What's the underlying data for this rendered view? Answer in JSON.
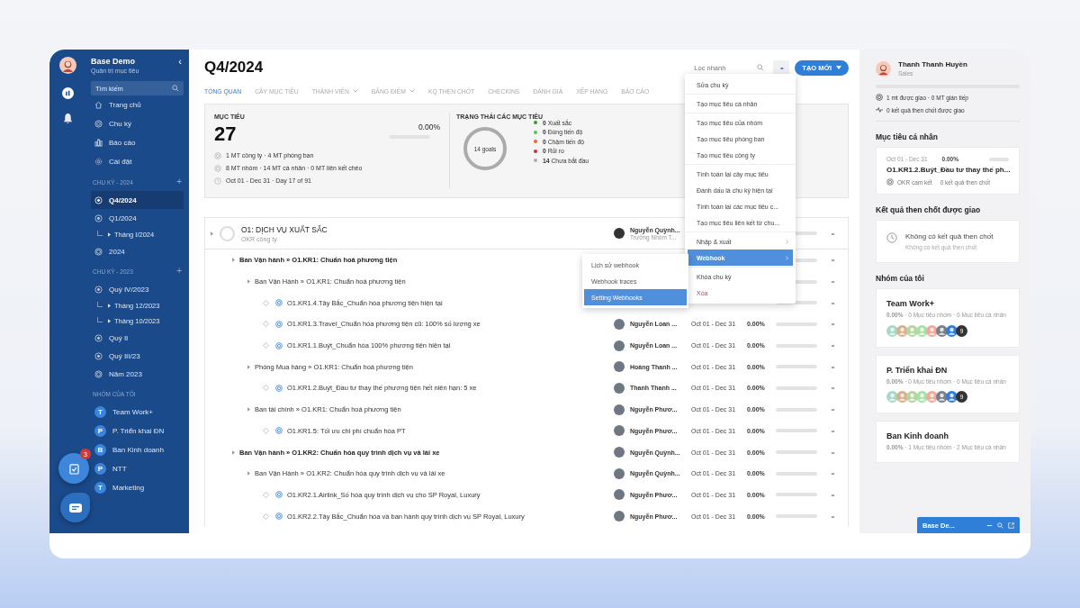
{
  "sidebar": {
    "brand": "Base Demo",
    "subtitle": "Quản trị mục tiêu",
    "collapse": "‹",
    "search": {
      "placeholder": "Tìm kiếm"
    },
    "nav": [
      {
        "label": "Trang chủ",
        "kind": "home"
      },
      {
        "label": "Chu kỳ",
        "kind": "target"
      },
      {
        "label": "Báo cáo",
        "kind": "chart"
      },
      {
        "label": "Cài đặt",
        "kind": "gear"
      }
    ],
    "sections": [
      {
        "title": "CHU KỲ - 2024",
        "add": "+",
        "items": [
          {
            "label": "Q4/2024",
            "kind": "quarter",
            "selected": true
          },
          {
            "label": "Q1/2024",
            "kind": "quarter",
            "selected": false,
            "children": [
              {
                "label": "Tháng I/2024",
                "selected": false
              }
            ]
          },
          {
            "label": "2024",
            "kind": "year",
            "selected": false
          }
        ]
      },
      {
        "title": "CHU KỲ - 2023",
        "add": "+",
        "items": [
          {
            "label": "Quý IV/2023",
            "kind": "quarter",
            "selected": false,
            "children": [
              {
                "label": "Tháng 12/2023",
                "selected": false
              },
              {
                "label": "Tháng 10/2023",
                "selected": false
              }
            ]
          },
          {
            "label": "Quý II",
            "kind": "quarter",
            "selected": false
          },
          {
            "label": "Quý III/23",
            "kind": "quarter",
            "selected": false
          },
          {
            "label": "Năm 2023",
            "kind": "year",
            "selected": false
          }
        ]
      }
    ],
    "groups_title": "NHÓM CỦA TÔI",
    "groups": [
      {
        "letter": "T",
        "label": "Team Work+"
      },
      {
        "letter": "P",
        "label": "P. Triển khai ĐN"
      },
      {
        "letter": "B",
        "label": "Ban Kinh doanh"
      },
      {
        "letter": "P",
        "label": "NTT"
      },
      {
        "letter": "T",
        "label": "Marketing"
      }
    ],
    "task_badge": "3"
  },
  "header": {
    "title": "Q4/2024",
    "filter": {
      "placeholder": "Lọc nhanh"
    },
    "more": "••",
    "create": "TẠO MỚI"
  },
  "tabs": [
    {
      "label": "TỔNG QUAN",
      "selected": true,
      "dropdown": false
    },
    {
      "label": "CÂY MỤC TIÊU",
      "selected": false,
      "dropdown": false
    },
    {
      "label": "THÀNH VIÊN",
      "selected": false,
      "dropdown": true
    },
    {
      "label": "BẢNG ĐIỂM",
      "selected": false,
      "dropdown": true
    },
    {
      "label": "KQ THEN CHỐT",
      "selected": false,
      "dropdown": false
    },
    {
      "label": "CHECKINS",
      "selected": false,
      "dropdown": false
    },
    {
      "label": "ĐÁNH GIÁ",
      "selected": false,
      "dropdown": false
    },
    {
      "label": "XẾP HẠNG",
      "selected": false,
      "dropdown": false
    },
    {
      "label": "BÁO CÁO",
      "selected": false,
      "dropdown": false
    }
  ],
  "summary": {
    "title": "MỤC TIÊU",
    "count": "27",
    "percent": "0.00%",
    "level": 0,
    "lines": [
      {
        "kind": "target",
        "text": "1 MT công ty · 4 MT phòng ban"
      },
      {
        "kind": "target",
        "text": "8 MT nhóm · 14 MT cá nhân · 0 MT liên kết chéo"
      },
      {
        "kind": "clock",
        "text": "Oct 01 - Dec 31 · Day 17 of 91"
      }
    ],
    "status_title": "TRẠNG THÁI CÁC MỤC TIÊU",
    "donut_label": "14 goals",
    "statuses": [
      {
        "count": "0",
        "label": "Xuất sắc",
        "color": "#3a9a2f"
      },
      {
        "count": "0",
        "label": "Đúng tiến độ",
        "color": "#4ccb4a"
      },
      {
        "count": "0",
        "label": "Chậm tiến độ",
        "color": "#f06430"
      },
      {
        "count": "0",
        "label": "Rủi ro",
        "color": "#c5303c"
      },
      {
        "count": "14",
        "label": "Chưa bắt đầu",
        "color": "#aaaaaa"
      }
    ]
  },
  "objective": {
    "title": "O1: DỊCH VỤ XUẤT SẮC",
    "type": "OKR công ty",
    "owner": "Nguyễn Quỳnh...",
    "role": "Trưởng Nhóm T...",
    "level": 0,
    "more": "••",
    "key_results": [
      {
        "kind": "group",
        "name": "Ban Vận hành » O1.KR1: Chuẩn hoá phương tiện",
        "level": 0,
        "more": "••",
        "children": [
          {
            "kind": "group",
            "name": "Ban Vận Hành » O1.KR1: Chuẩn hoá phương tiện",
            "level": 0,
            "more": "••",
            "children": [
              {
                "kind": "kr",
                "name": "O1.KR1.4.Tây Bắc_Chuẩn hóa phương tiện hiện tại",
                "level": 0,
                "more": "••"
              },
              {
                "kind": "kr",
                "name": "O1.KR1.3.Travel_Chuẩn hóa phương tiện cũ: 100% số lượng xe",
                "owner": "Nguyễn Loan ...",
                "date": "Oct 01 - Dec 31",
                "percent": "0.00%",
                "level": 0,
                "more": "••"
              },
              {
                "kind": "kr",
                "name": "O1.KR1.1.Buýt_Chuẩn hóa 100% phương tiện hiện tại",
                "owner": "Nguyễn Loan ...",
                "date": "Oct 01 - Dec 31",
                "percent": "0.00%",
                "level": 0,
                "more": "••"
              }
            ]
          },
          {
            "kind": "group",
            "name": "Phòng Mua hàng » O1.KR1: Chuẩn hoá phương tiện",
            "owner": "Hoàng Thanh ...",
            "date": "Oct 01 - Dec 31",
            "percent": "0.00%",
            "level": 0,
            "more": "••",
            "children": [
              {
                "kind": "kr",
                "name": "O1.KR1.2.Buýt_Đầu tư thay thế phương tiện hết niên hạn: 5 xe",
                "owner": "Thanh Thanh ...",
                "date": "Oct 01 - Dec 31",
                "percent": "0.00%",
                "level": 0,
                "more": "••"
              }
            ]
          },
          {
            "kind": "group",
            "name": "Ban tài chính » O1.KR1: Chuẩn hoá phương tiện",
            "owner": "Nguyễn Phươ...",
            "date": "Oct 01 - Dec 31",
            "percent": "0.00%",
            "level": 0,
            "more": "••",
            "children": [
              {
                "kind": "kr",
                "name": "O1.KR1.5: Tối ưu chi phí chuẩn hóa PT",
                "owner": "Nguyễn Phươ...",
                "date": "Oct 01 - Dec 31",
                "percent": "0.00%",
                "level": 0,
                "more": "••"
              }
            ]
          }
        ]
      },
      {
        "kind": "group",
        "name": "Ban Vận hành » O1.KR2: Chuẩn hóa quy trình dịch vụ và lái xe",
        "owner": "Nguyễn Quỳnh...",
        "date": "Oct 01 - Dec 31",
        "percent": "0.00%",
        "level": 0,
        "more": "••",
        "children": [
          {
            "kind": "group",
            "name": "Ban Vận Hành » O1.KR2: Chuẩn hóa quy trình dịch vụ và lái xe",
            "owner": "Nguyễn Quỳnh...",
            "date": "Oct 01 - Dec 31",
            "percent": "0.00%",
            "level": 0,
            "more": "••",
            "children": [
              {
                "kind": "kr",
                "name": "O1.KR2.1.Airlink_Số hóa quy trình dịch vụ cho SP Royal, Luxury",
                "owner": "Nguyễn Phươ...",
                "date": "Oct 01 - Dec 31",
                "percent": "0.00%",
                "level": 0,
                "more": "••"
              },
              {
                "kind": "kr",
                "name": "O1.KR2.2.Tây Bắc_Chuẩn hóa và ban hành quy trình dịch vụ SP Royal, Luxury",
                "owner": "Nguyễn Phươ...",
                "date": "Oct 01 - Dec 31",
                "percent": "0.00%",
                "level": 0,
                "more": "••"
              }
            ]
          }
        ]
      }
    ]
  },
  "menu": {
    "groups": [
      [
        {
          "label": "Sửa chu kỳ",
          "kind": "item",
          "selected": false
        }
      ],
      [
        {
          "label": "Tạo mục tiêu cá nhân",
          "kind": "item",
          "selected": false
        }
      ],
      [
        {
          "label": "Tạo mục tiêu của nhóm",
          "kind": "item",
          "selected": false
        },
        {
          "label": "Tạo mục tiêu phòng ban",
          "kind": "item",
          "selected": false
        },
        {
          "label": "Tạo mục tiêu công ty",
          "kind": "item",
          "selected": false
        }
      ],
      [
        {
          "label": "Tính toán lại cây mục tiêu",
          "kind": "item",
          "selected": false
        },
        {
          "label": "Đánh dấu là chu kỳ hiện tại",
          "kind": "item",
          "selected": false
        },
        {
          "label": "Tính toán lại các mục tiêu c...",
          "kind": "item",
          "selected": false
        },
        {
          "label": "Tạo mục tiêu liên kết từ chu...",
          "kind": "item",
          "selected": false
        }
      ],
      [
        {
          "label": "Nhập & xuất",
          "kind": "submenu",
          "selected": false
        },
        {
          "label": "Webhook",
          "kind": "submenu",
          "selected": true
        }
      ],
      [
        {
          "label": "Khóa chu kỳ",
          "kind": "item",
          "selected": false
        },
        {
          "label": "Xóa",
          "kind": "danger",
          "selected": false
        }
      ]
    ],
    "submenu": [
      {
        "label": "Lịch sử webhook",
        "selected": false
      },
      {
        "label": "Webhook traces",
        "selected": false
      },
      {
        "label": "Setting Webhooks",
        "selected": true
      }
    ]
  },
  "profile": {
    "name": "Thanh Thanh Huyền",
    "role": "Sales",
    "level": 0,
    "assigned": "1 mt được giao · 0 MT gián tiếp",
    "kr_assigned": "0 kết quả then chốt được giao"
  },
  "personal": {
    "title": "Mục tiêu cá nhân",
    "date": "Oct 01 - Dec 31",
    "percent": "0.00%",
    "level": 0,
    "name": "O1.KR1.2.Buýt_Đầu tư thay thế ph...",
    "type": "OKR cam kết",
    "kr_count": "0 kết quả then chốt"
  },
  "assigned_kr": {
    "title": "Kết quả then chốt được giao",
    "empty_title": "Không có kết quả then chốt",
    "empty_text": "Không có kết quả then chốt"
  },
  "my_groups": {
    "title": "Nhóm của tôi",
    "cards": [
      {
        "name": "Team Work+",
        "stats": "**0.00%** · 0 Mục tiêu nhóm · 0 Mục tiêu cá nhân",
        "more": "9"
      },
      {
        "name": "P. Triển khai ĐN",
        "stats": "**0.00%** · 0 Mục tiêu nhóm · 0 Mục tiêu cá nhân",
        "more": "9"
      },
      {
        "name": "Ban Kinh doanh",
        "stats": "**0.00%** · 1 Mục tiêu nhóm · 2 Mục tiêu cá nhân"
      }
    ]
  },
  "chat_bar": {
    "title": "Base De..."
  }
}
